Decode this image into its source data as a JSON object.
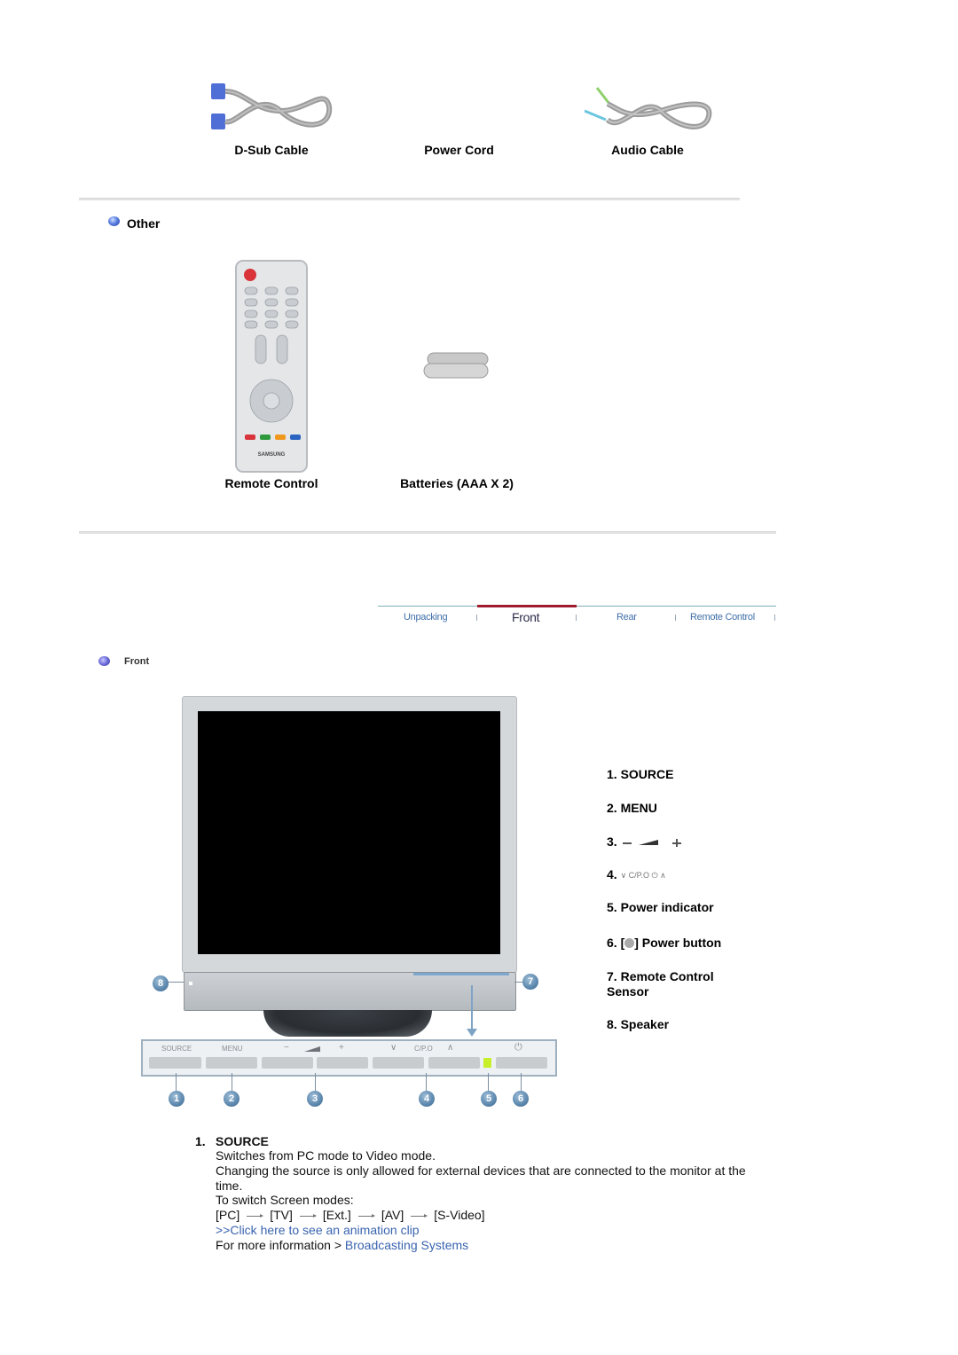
{
  "accessories": {
    "cables": [
      {
        "label": "D-Sub Cable",
        "icon": "dsub-cable-icon"
      },
      {
        "label": "Power Cord",
        "icon": "power-cord-icon"
      },
      {
        "label": "Audio Cable",
        "icon": "audio-cable-icon"
      }
    ],
    "other_heading": "Other",
    "other_items": [
      {
        "label": "Remote Control",
        "icon": "remote-control-icon",
        "brand": "SAMSUNG"
      },
      {
        "label": "Batteries (AAA X 2)",
        "icon": "batteries-icon"
      }
    ]
  },
  "nav_tabs": {
    "items": [
      {
        "label": "Unpacking",
        "active": false
      },
      {
        "label": "Front",
        "active": true
      },
      {
        "label": "Rear",
        "active": false
      },
      {
        "label": "Remote Control",
        "active": false
      }
    ],
    "active_color": "#a01c2c",
    "line_color": "#7fb0b8"
  },
  "front": {
    "section_title": "Front",
    "panel_labels": [
      "SOURCE",
      "MENU",
      "−",
      "+",
      "∨",
      "C/P.O",
      "∧",
      "⏻"
    ],
    "callouts": [
      "1",
      "2",
      "3",
      "4",
      "5",
      "6",
      "7",
      "8"
    ],
    "features": [
      {
        "num": "1.",
        "label": "SOURCE"
      },
      {
        "num": "2.",
        "label": "MENU"
      },
      {
        "num": "3.",
        "label": "− ◢ +"
      },
      {
        "num": "4.",
        "label": "∨ C/P.O ∧"
      },
      {
        "num": "5.",
        "label": "Power indicator"
      },
      {
        "num": "6.",
        "label_pre": "[",
        "label_post": "] Power button"
      },
      {
        "num": "7.",
        "label": "Remote Control Sensor"
      },
      {
        "num": "8.",
        "label": "Speaker"
      }
    ]
  },
  "description": {
    "num": "1.",
    "title": "SOURCE",
    "line1": "Switches from PC mode to Video mode.",
    "line2": "Changing the source is only allowed for external devices that are connected to the monitor at the time.",
    "line3": "To switch Screen modes:",
    "modes": [
      "[PC]",
      "[TV]",
      "[Ext.]",
      "[AV]",
      "[S-Video]"
    ],
    "animation_link": ">>Click here to see an animation clip",
    "more_info_prefix": "For more information > ",
    "more_info_link": "Broadcasting Systems"
  }
}
